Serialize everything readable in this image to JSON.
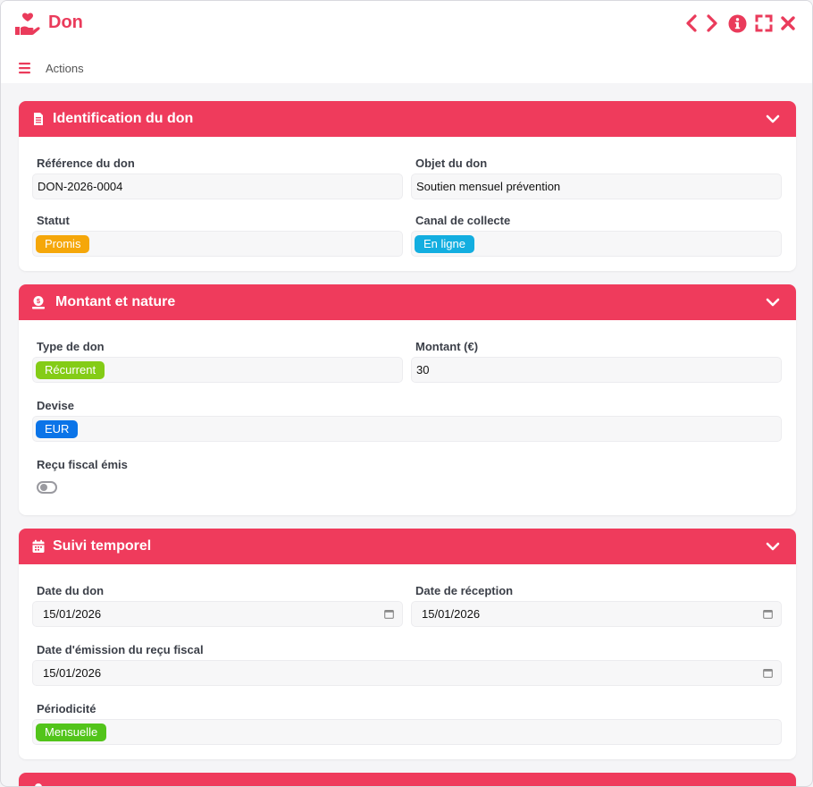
{
  "window": {
    "title": "Don",
    "actions_label": "Actions",
    "icons": [
      "hand-heart-icon",
      "chevron-left-icon",
      "chevron-right-icon",
      "info-icon",
      "fullscreen-icon",
      "close-icon",
      "menu-icon"
    ]
  },
  "sections": {
    "identification": {
      "title": "Identification du don",
      "reference_label": "Référence du don",
      "reference_value": "DON-2026-0004",
      "objet_label": "Objet du don",
      "objet_value": "Soutien mensuel prévention",
      "statut_label": "Statut",
      "statut_value": "Promis",
      "canal_label": "Canal de collecte",
      "canal_value": "En ligne"
    },
    "montant": {
      "title": "Montant et nature",
      "type_label": "Type de don",
      "type_value": "Récurrent",
      "montant_label": "Montant (€)",
      "montant_value": "30",
      "devise_label": "Devise",
      "devise_value": "EUR",
      "recu_label": "Reçu fiscal émis",
      "recu_value": false
    },
    "suivi": {
      "title": "Suivi temporel",
      "date_don_label": "Date du don",
      "date_don_value": "15/01/2026",
      "date_reception_label": "Date de réception",
      "date_reception_value": "15/01/2026",
      "date_recu_label": "Date d'émission du reçu fiscal",
      "date_recu_value": "15/01/2026",
      "periodicite_label": "Périodicité",
      "periodicite_value": "Mensuelle"
    }
  },
  "colors": {
    "accent": "#ef3b5c",
    "tag_promis": "#f5a70a",
    "tag_en_ligne": "#13aee0",
    "tag_recurrent": "#84cc16",
    "tag_eur": "#0b74e8",
    "tag_mensuelle": "#52c41a"
  }
}
